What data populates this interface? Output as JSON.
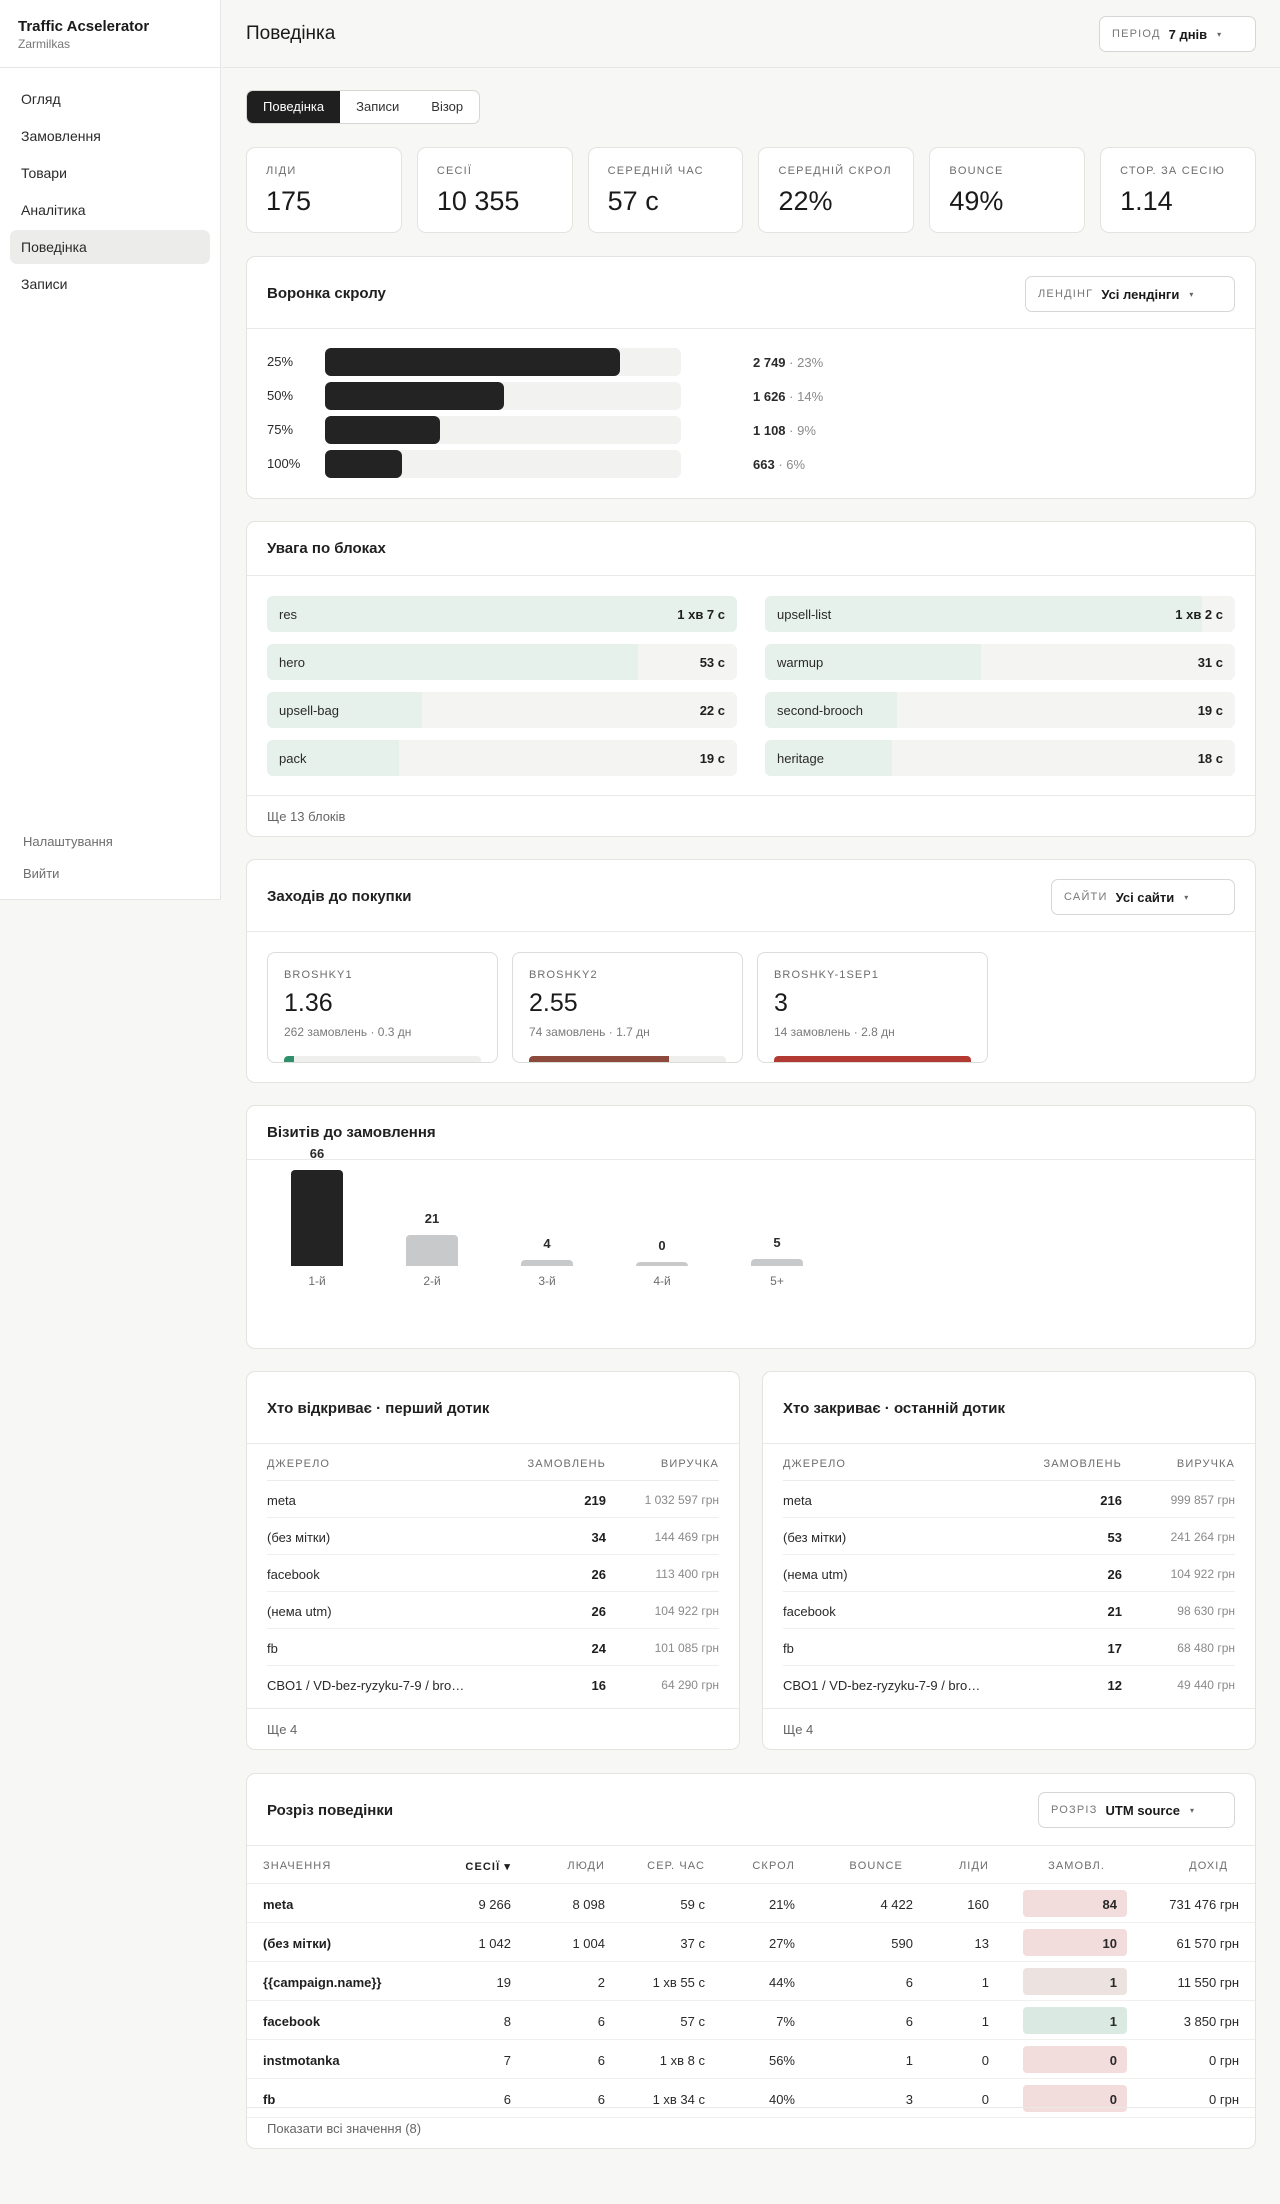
{
  "app": {
    "name": "Traffic Acselerator",
    "account": "Zarmilkas"
  },
  "sidebar": {
    "items": [
      "Огляд",
      "Замовлення",
      "Товари",
      "Аналітика",
      "Поведінка",
      "Записи"
    ],
    "active": "Поведінка",
    "bottom": [
      "Налаштування",
      "Вийти"
    ]
  },
  "header": {
    "title": "Поведінка",
    "period_label": "Період",
    "period_value": "7 днів"
  },
  "tabs": [
    "Поведінка",
    "Записи",
    "Візор"
  ],
  "kpis": [
    {
      "label": "Ліди",
      "value": "175"
    },
    {
      "label": "Сесії",
      "value": "10 355"
    },
    {
      "label": "Середній час",
      "value": "57 с"
    },
    {
      "label": "Середній скрол",
      "value": "22%"
    },
    {
      "label": "Bounce",
      "value": "49%"
    },
    {
      "label": "Стор. за сесію",
      "value": "1.14"
    }
  ],
  "funnel": {
    "title": "Воронка скролу",
    "filter_label": "Лендінг",
    "filter_value": "Усі лендінги",
    "rows": [
      {
        "label": "25%",
        "count": "2 749",
        "share": "23%",
        "fill": 0.23
      },
      {
        "label": "50%",
        "count": "1 626",
        "share": "14%",
        "fill": 0.14
      },
      {
        "label": "75%",
        "count": "1 108",
        "share": "9%",
        "fill": 0.09
      },
      {
        "label": "100%",
        "count": "663",
        "share": "6%",
        "fill": 0.06
      }
    ]
  },
  "attention": {
    "title": "Увага по блоках",
    "blocks": [
      {
        "name": "res",
        "value": "1 хв 7 с",
        "fill": 1.0
      },
      {
        "name": "upsell-list",
        "value": "1 хв 2 с",
        "fill": 0.93
      },
      {
        "name": "hero",
        "value": "53 с",
        "fill": 0.79
      },
      {
        "name": "warmup",
        "value": "31 с",
        "fill": 0.46
      },
      {
        "name": "upsell-bag",
        "value": "22 с",
        "fill": 0.33
      },
      {
        "name": "second-brooch",
        "value": "19 с",
        "fill": 0.28
      },
      {
        "name": "pack",
        "value": "19 с",
        "fill": 0.28
      },
      {
        "name": "heritage",
        "value": "18 с",
        "fill": 0.27
      }
    ],
    "more": "Ще 13 блоків"
  },
  "steps": {
    "title": "Заходів до покупки",
    "filter_label": "Сайти",
    "filter_value": "Усі сайти",
    "sites": [
      {
        "name": "BROSHKY1",
        "value": "1.36",
        "sub": "262 замовлень · 0.3 дн",
        "color": "#2f8f6b",
        "fill": 0.05
      },
      {
        "name": "BROSHKY2",
        "value": "2.55",
        "sub": "74 замовлень · 1.7 дн",
        "color": "#8c4a3c",
        "fill": 0.71
      },
      {
        "name": "BROSHKY-1SEP1",
        "value": "3",
        "sub": "14 замовлень · 2.8 дн",
        "color": "#b23a33",
        "fill": 1.0
      }
    ]
  },
  "visits": {
    "title": "Візитів до замовлення",
    "chart_data": {
      "type": "bar",
      "categories": [
        "1-й",
        "2-й",
        "3-й",
        "4-й",
        "5+"
      ],
      "values": [
        66,
        21,
        4,
        0,
        5
      ],
      "highlight_color": "#232323",
      "bar_color": "#c8c9ca"
    }
  },
  "first_touch": {
    "title": "Хто відкриває · перший дотик",
    "columns": [
      "Джерело",
      "Замовлень",
      "Виручка"
    ],
    "rows": [
      [
        "meta",
        "219",
        "1 032 597 грн"
      ],
      [
        "(без мітки)",
        "34",
        "144 469 грн"
      ],
      [
        "facebook",
        "26",
        "113 400 грн"
      ],
      [
        "(нема utm)",
        "26",
        "104 922 грн"
      ],
      [
        "fb",
        "24",
        "101 085 грн"
      ],
      [
        "CBO1 / VD-bez-ryzyku-7-9 / broshky-1sep1",
        "16",
        "64 290 грн"
      ]
    ],
    "more": "Ще 4"
  },
  "last_touch": {
    "title": "Хто закриває · останній дотик",
    "columns": [
      "Джерело",
      "Замовлень",
      "Виручка"
    ],
    "rows": [
      [
        "meta",
        "216",
        "999 857 грн"
      ],
      [
        "(без мітки)",
        "53",
        "241 264 грн"
      ],
      [
        "(нема utm)",
        "26",
        "104 922 грн"
      ],
      [
        "facebook",
        "21",
        "98 630 грн"
      ],
      [
        "fb",
        "17",
        "68 480 грн"
      ],
      [
        "CBO1 / VD-bez-ryzyku-7-9 / broshky-1sep1",
        "12",
        "49 440 грн"
      ]
    ],
    "more": "Ще 4"
  },
  "breakdown": {
    "title": "Розріз поведінки",
    "filter_label": "Розріз",
    "filter_value": "UTM source",
    "columns": [
      "Значення",
      "Сесії ▾",
      "Люди",
      "Сер. час",
      "Скрол",
      "Bounce",
      "Ліди",
      "Замовл.",
      "Дохід"
    ],
    "rows": [
      {
        "name": "meta",
        "sessions": "9 266",
        "people": "8 098",
        "time": "59 с",
        "scroll": "21%",
        "bounce": "4 422",
        "leads": "160",
        "orders": "84",
        "revenue": "731 476 грн",
        "pill": "#f2dcdc"
      },
      {
        "name": "(без мітки)",
        "sessions": "1 042",
        "people": "1 004",
        "time": "37 с",
        "scroll": "27%",
        "bounce": "590",
        "leads": "13",
        "orders": "10",
        "revenue": "61 570 грн",
        "pill": "#f2dcdc"
      },
      {
        "name": "{{campaign.name}}",
        "sessions": "19",
        "people": "2",
        "time": "1 хв 55 с",
        "scroll": "44%",
        "bounce": "6",
        "leads": "1",
        "orders": "1",
        "revenue": "11 550 грн",
        "pill": "#ece3e1"
      },
      {
        "name": "facebook",
        "sessions": "8",
        "people": "6",
        "time": "57 с",
        "scroll": "7%",
        "bounce": "6",
        "leads": "1",
        "orders": "1",
        "revenue": "3 850 грн",
        "pill": "#dbe9e3"
      },
      {
        "name": "instmotanka",
        "sessions": "7",
        "people": "6",
        "time": "1 хв 8 с",
        "scroll": "56%",
        "bounce": "1",
        "leads": "0",
        "orders": "0",
        "revenue": "0 грн",
        "pill": "#f2dcdc"
      },
      {
        "name": "fb",
        "sessions": "6",
        "people": "6",
        "time": "1 хв 34 с",
        "scroll": "40%",
        "bounce": "3",
        "leads": "0",
        "orders": "0",
        "revenue": "0 грн",
        "pill": "#f2dcdc"
      }
    ],
    "more": "Показати всі значення (8)"
  }
}
